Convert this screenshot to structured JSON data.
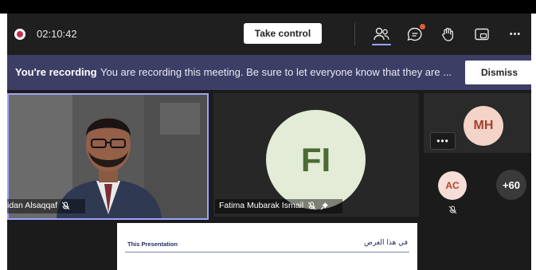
{
  "topbar": {
    "timer": "02:10:42",
    "take_control_label": "Take control",
    "icons": [
      "people-icon",
      "chat-icon",
      "raise-hand-icon",
      "share-tray-icon",
      "more-icon"
    ],
    "more_label": "•••"
  },
  "banner": {
    "title": "You're recording",
    "message": "You are recording this meeting. Be sure to let everyone know that they are ...",
    "dismiss_label": "Dismiss"
  },
  "participants": {
    "speaker_name": "idan Alsaqqaf",
    "fi_initials": "FI",
    "fi_name": "Fatima Mubarak Ismail",
    "mh_initials": "MH",
    "ac_initials": "AC",
    "overflow_count": "+60",
    "more_options_label": "•••"
  },
  "slide": {
    "title_en": "This Presentation",
    "title_ar": "في هذا العرض"
  },
  "colors": {
    "accent": "#9ea2ff",
    "banner_bg": "#3d3e66",
    "record_red": "#c4314b",
    "fi_avatar_bg": "#e2ecd6",
    "mh_avatar_bg": "#f4d3c8"
  }
}
